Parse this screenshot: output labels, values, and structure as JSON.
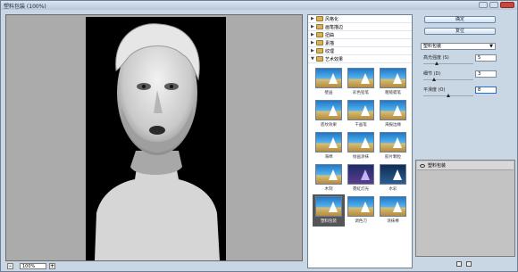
{
  "window": {
    "title": "塑料包装 (100%)"
  },
  "preview": {
    "zoom": "100%",
    "zoom_out": "-",
    "zoom_in": "+"
  },
  "categories": [
    {
      "label": "风格化",
      "expanded": false
    },
    {
      "label": "画笔描边",
      "expanded": false
    },
    {
      "label": "扭曲",
      "expanded": false
    },
    {
      "label": "素描",
      "expanded": false
    },
    {
      "label": "纹理",
      "expanded": false
    },
    {
      "label": "艺术效果",
      "expanded": true
    }
  ],
  "art_filters": [
    "壁画",
    "彩色铅笔",
    "粗糙蜡笔",
    "底纹效果",
    "干画笔",
    "海报边缘",
    "海绵",
    "绘画涂抹",
    "胶片颗粒",
    "木刻",
    "霓虹灯光",
    "水彩",
    "塑料包装",
    "调色刀",
    "涂抹棒"
  ],
  "selected_filter": "塑料包装",
  "buttons": {
    "ok": "确定",
    "reset": "复位"
  },
  "filter_select": {
    "value": "塑料包装"
  },
  "params": [
    {
      "label": "高光强度 (S)",
      "value": "5",
      "level": 0.25
    },
    {
      "label": "细节 (D)",
      "value": "3",
      "level": 0.2
    },
    {
      "label": "平滑度 (O)",
      "value": "8",
      "level": 0.5
    }
  ],
  "layers": [
    {
      "label": "塑料包装"
    }
  ]
}
